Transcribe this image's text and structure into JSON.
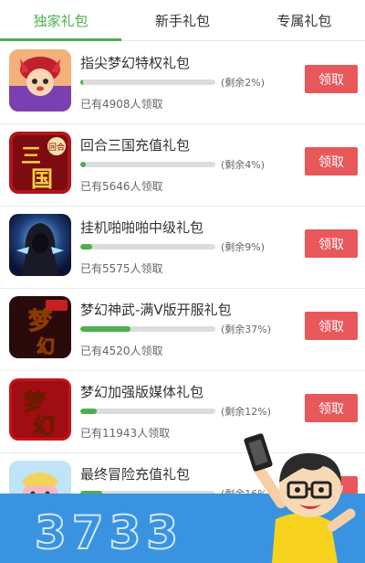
{
  "tabs": [
    {
      "label": "独家礼包",
      "active": true
    },
    {
      "label": "新手礼包",
      "active": false
    },
    {
      "label": "专属礼包",
      "active": false
    }
  ],
  "items": [
    {
      "title": "指尖梦幻特权礼包",
      "remaining_label": "(剩余2%)",
      "remaining_percent": 2,
      "claimed": "已有4908人领取",
      "action": "领取",
      "icon": "cartoon-character-icon"
    },
    {
      "title": "回合三国充值礼包",
      "remaining_label": "(剩余4%)",
      "remaining_percent": 4,
      "claimed": "已有5646人领取",
      "action": "领取",
      "icon": "three-kingdoms-logo-icon",
      "icon_text": "三国",
      "icon_badge": "回合"
    },
    {
      "title": "挂机啪啪啪中级礼包",
      "remaining_label": "(剩余9%)",
      "remaining_percent": 9,
      "claimed": "已有5575人领取",
      "action": "领取",
      "icon": "hooded-figure-icon"
    },
    {
      "title": "梦幻神武-满V版开服礼包",
      "remaining_label": "(剩余37%)",
      "remaining_percent": 37,
      "claimed": "已有4520人领取",
      "action": "领取",
      "icon": "dream-logo-icon",
      "icon_text": "梦幻"
    },
    {
      "title": "梦幻加强版媒体礼包",
      "remaining_label": "(剩余12%)",
      "remaining_percent": 12,
      "claimed": "已有11943人领取",
      "action": "领取",
      "icon": "dream-logo-icon",
      "icon_text": "梦幻"
    },
    {
      "title": "最终冒险充值礼包",
      "remaining_label": "(剩余16%)",
      "remaining_percent": 16,
      "claimed": "",
      "action": "领取",
      "icon": "cartoon-pig-icon"
    }
  ],
  "banner": {
    "logo_text": "3733"
  },
  "colors": {
    "accent": "#4cb050",
    "button": "#e8585a",
    "banner": "#3a93e0"
  }
}
